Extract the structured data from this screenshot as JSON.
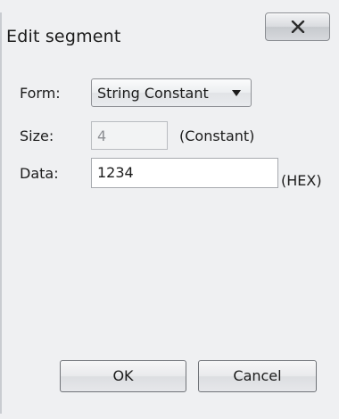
{
  "window": {
    "title": "Edit segment",
    "close_icon": "close-x-icon"
  },
  "form": {
    "form_label": "Form:",
    "form_value": "String Constant",
    "size_label": "Size:",
    "size_value": "4",
    "size_suffix": "(Constant)",
    "data_label": "Data:",
    "data_value": "1234",
    "data_suffix": "(HEX)"
  },
  "buttons": {
    "ok_label": "OK",
    "cancel_label": "Cancel"
  }
}
